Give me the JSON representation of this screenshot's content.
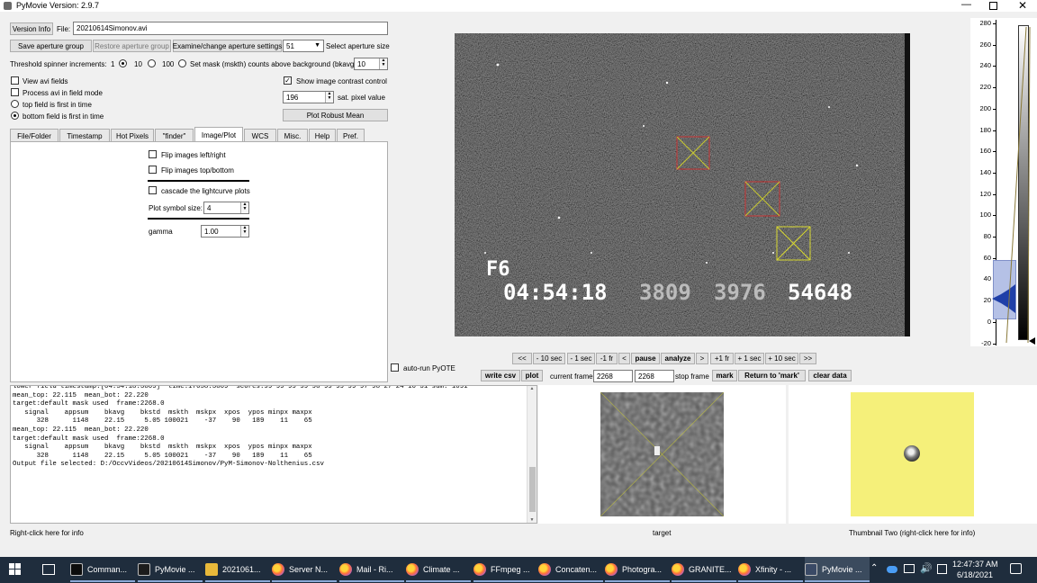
{
  "title_bar": {
    "title": "PyMovie  Version: 2.9.7"
  },
  "top": {
    "version_info": "Version Info",
    "file_label": "File:",
    "file_value": "20210614Simonov.avi",
    "save_group": "Save aperture group",
    "restore_group": "Restore aperture group",
    "examine": "Examine/change aperture settings",
    "aperture_size": "51",
    "select_size_label": "Select aperture size",
    "threshold_label": "Threshold spinner increments:",
    "inc1": "1",
    "inc10": "10",
    "inc100": "100",
    "mask_label": "Set mask (mskth) counts above background (bkavg)",
    "mask_value": "10"
  },
  "options": {
    "view_avi": "View avi fields",
    "process_avi": "Process avi in field mode",
    "top_first": "top field is first in time",
    "bottom_first": "bottom field is first in time",
    "show_contrast": "Show image contrast control",
    "sat_value": "196",
    "sat_label": "sat. pixel value",
    "plot_robust": "Plot Robust Mean"
  },
  "tabs": [
    "File/Folder",
    "Timestamp",
    "Hot Pixels",
    "\"finder\"",
    "Image/Plot",
    "WCS",
    "Misc.",
    "Help",
    "Pref."
  ],
  "image_plot": {
    "flip_lr": "Flip images left/right",
    "flip_tb": "Flip images top/bottom",
    "cascade": "cascade the lightcurve plots",
    "symbol_label": "Plot symbol size:",
    "symbol_value": "4",
    "gamma_label": "gamma",
    "gamma_value": "1.00"
  },
  "video": {
    "field_label": "F6",
    "timestamp": "04:54:18",
    "n1": "3809",
    "n2": "3976",
    "n3": "54648"
  },
  "histogram": {
    "ticks": [
      "280",
      "260",
      "240",
      "220",
      "200",
      "180",
      "160",
      "140",
      "120",
      "100",
      "80",
      "60",
      "40",
      "20",
      "0",
      "-20"
    ]
  },
  "nav": {
    "buttons": [
      "<<",
      "- 10 sec",
      "- 1 sec",
      "-1 fr",
      "<",
      "pause",
      "analyze",
      ">",
      "+1 fr",
      "+ 1 sec",
      "+ 10 sec",
      ">>"
    ]
  },
  "controls": {
    "auto_run": "auto-run PyOTE",
    "write_csv": "write csv",
    "plot": "plot",
    "current_frame_label": "current frame",
    "current_frame": "2268",
    "stop_value": "2268",
    "stop_frame_label": "stop frame",
    "mark": "mark",
    "return_mark": "Return to 'mark'",
    "clear_data": "clear data"
  },
  "log": {
    "lines": [
      "lower field timestamp:[04:54:18.3809]  time:17658.3809  scores:99 99 99 99 98 99 99 99 97 98 27 24 16 31 sum: 1091",
      "",
      "mean_top: 22.115  mean_bot: 22.220",
      "",
      "target:default mask used  frame:2268.0",
      "   signal    appsum    bkavg    bkstd  mskth  mskpx  xpos  ypos minpx maxpx",
      "      328      1148    22.15     5.05 100021    -37    90   189    11    65",
      "",
      "mean_top: 22.115  mean_bot: 22.220",
      "",
      "target:default mask used  frame:2268.0",
      "   signal    appsum    bkavg    bkstd  mskth  mskpx  xpos  ypos minpx maxpx",
      "      328      1148    22.15     5.05 100021    -37    90   189    11    65",
      "",
      "Output file selected: D:/OccvVideos/20210614Simonov/PyM-Simonov-Nolthenius.csv"
    ]
  },
  "thumbs": {
    "target_label": "target",
    "thumb2_label": "Thumbnail Two (right-click here for info)"
  },
  "status": {
    "left": "Right-click here for info"
  },
  "taskbar": {
    "items": [
      "Comman...",
      "PyMovie ...",
      "2021061...",
      "Server N...",
      "Mail - Ri...",
      "Climate ...",
      "FFmpeg ...",
      "Concaten...",
      "Photogra...",
      "GRANITE...",
      "Xfinity - ...",
      "PyMovie ..."
    ],
    "time": "12:47:37 AM",
    "date": "6/18/2021"
  },
  "colors": {
    "taskbar_bg": "#1f2d3d",
    "thumb2_bg": "#f5f07a",
    "aperture_red": "#c83232",
    "aperture_yellow": "#d8d830"
  }
}
